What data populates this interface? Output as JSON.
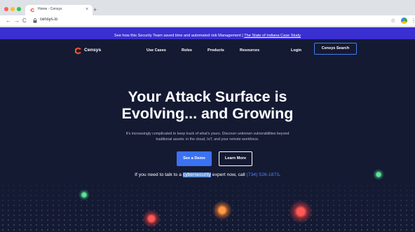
{
  "browser": {
    "tab_title": "Home - Censys",
    "tab_close": "×",
    "new_tab": "+",
    "back": "←",
    "forward": "→",
    "reload": "C",
    "url": "censys.io",
    "star": "☆",
    "menu": "⋮"
  },
  "banner": {
    "text": "See how this Security Team saved time and automated risk Management | ",
    "link": "The State of Indiana Case Study"
  },
  "header": {
    "logo_text": "Censys",
    "nav": [
      "Use Cases",
      "Roles",
      "Products",
      "Resources"
    ],
    "login": "Login",
    "search_button": "Censys Search"
  },
  "hero": {
    "headline_line1": "Your Attack Surface is",
    "headline_line2": "Evolving... and Growing",
    "subtext_line1": "It's increasingly complicated to keep track of what's yours. Discover unknown vulnerabilities beyond",
    "subtext_line2": "traditional assets: in the cloud, IoT, and your remote workforce.",
    "cta_demo": "See a Demo",
    "cta_learn": "Learn More",
    "talk_prefix": "If you need to talk to a ",
    "talk_highlight": "cybersecurity",
    "talk_middle": " expert now, call ",
    "talk_phone": "(734) 526-1873",
    "talk_suffix": "."
  },
  "colors": {
    "banner": "#3a2fd0",
    "hero_bg": "#151a33",
    "accent": "#3b72f2",
    "logo_orange": "#f0562b"
  }
}
